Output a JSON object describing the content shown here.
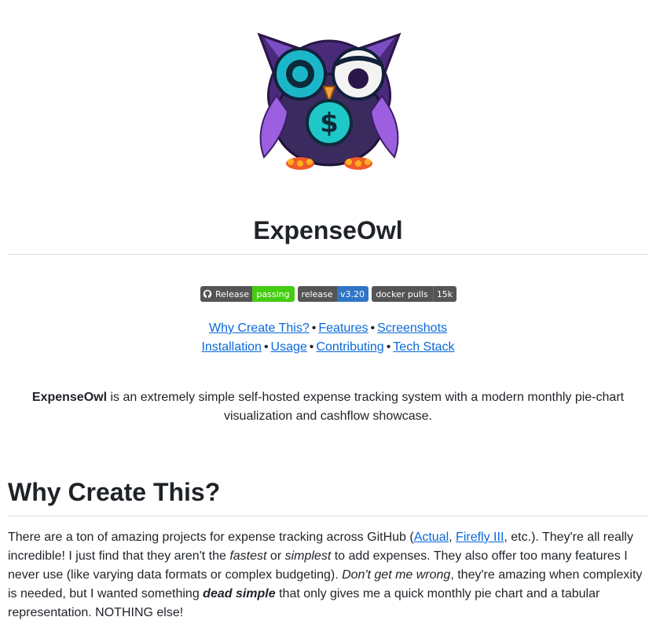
{
  "header": {
    "logo_icon": "owl-dollar-logo-icon",
    "title": "ExpenseOwl"
  },
  "badges": [
    {
      "icon": "github-icon",
      "label": "Release",
      "value": "passing",
      "color": "#44cc11"
    },
    {
      "label": "release",
      "value": "v3.20",
      "color": "#2f76c6"
    },
    {
      "label": "docker pulls",
      "value": "15k",
      "color": "#555555"
    }
  ],
  "nav": {
    "row1": [
      "Why Create This?",
      "Features",
      "Screenshots"
    ],
    "row2": [
      "Installation",
      "Usage",
      "Contributing",
      "Tech Stack"
    ],
    "separator": "•"
  },
  "intro": {
    "strong": "ExpenseOwl",
    "text": " is an extremely simple self-hosted expense tracking system with a modern monthly pie-chart visualization and cashflow showcase."
  },
  "section": {
    "heading": "Why Create This?",
    "p1": "There are a ton of amazing projects for expense tracking across GitHub (",
    "link1": "Actual",
    "comma": ", ",
    "link2": "Firefly III",
    "p2": ", etc.). They're all really incredible! I just find that they aren't the ",
    "em1": "fastest",
    "or": " or ",
    "em2": "simplest",
    "p3": " to add expenses. They also offer too many features I never use (like varying data formats or complex budgeting). ",
    "em3": "Don't get me wrong",
    "p4": ", they're amazing when complexity is needed, but I wanted something ",
    "strong_em": "dead simple",
    "p5": " that only gives me a quick monthly pie chart and a tabular representation. NOTHING else!"
  },
  "colors": {
    "link": "#0969da",
    "text": "#1f2328",
    "badge_green": "#44cc11",
    "badge_blue": "#2f76c6",
    "badge_gray": "#555555"
  }
}
